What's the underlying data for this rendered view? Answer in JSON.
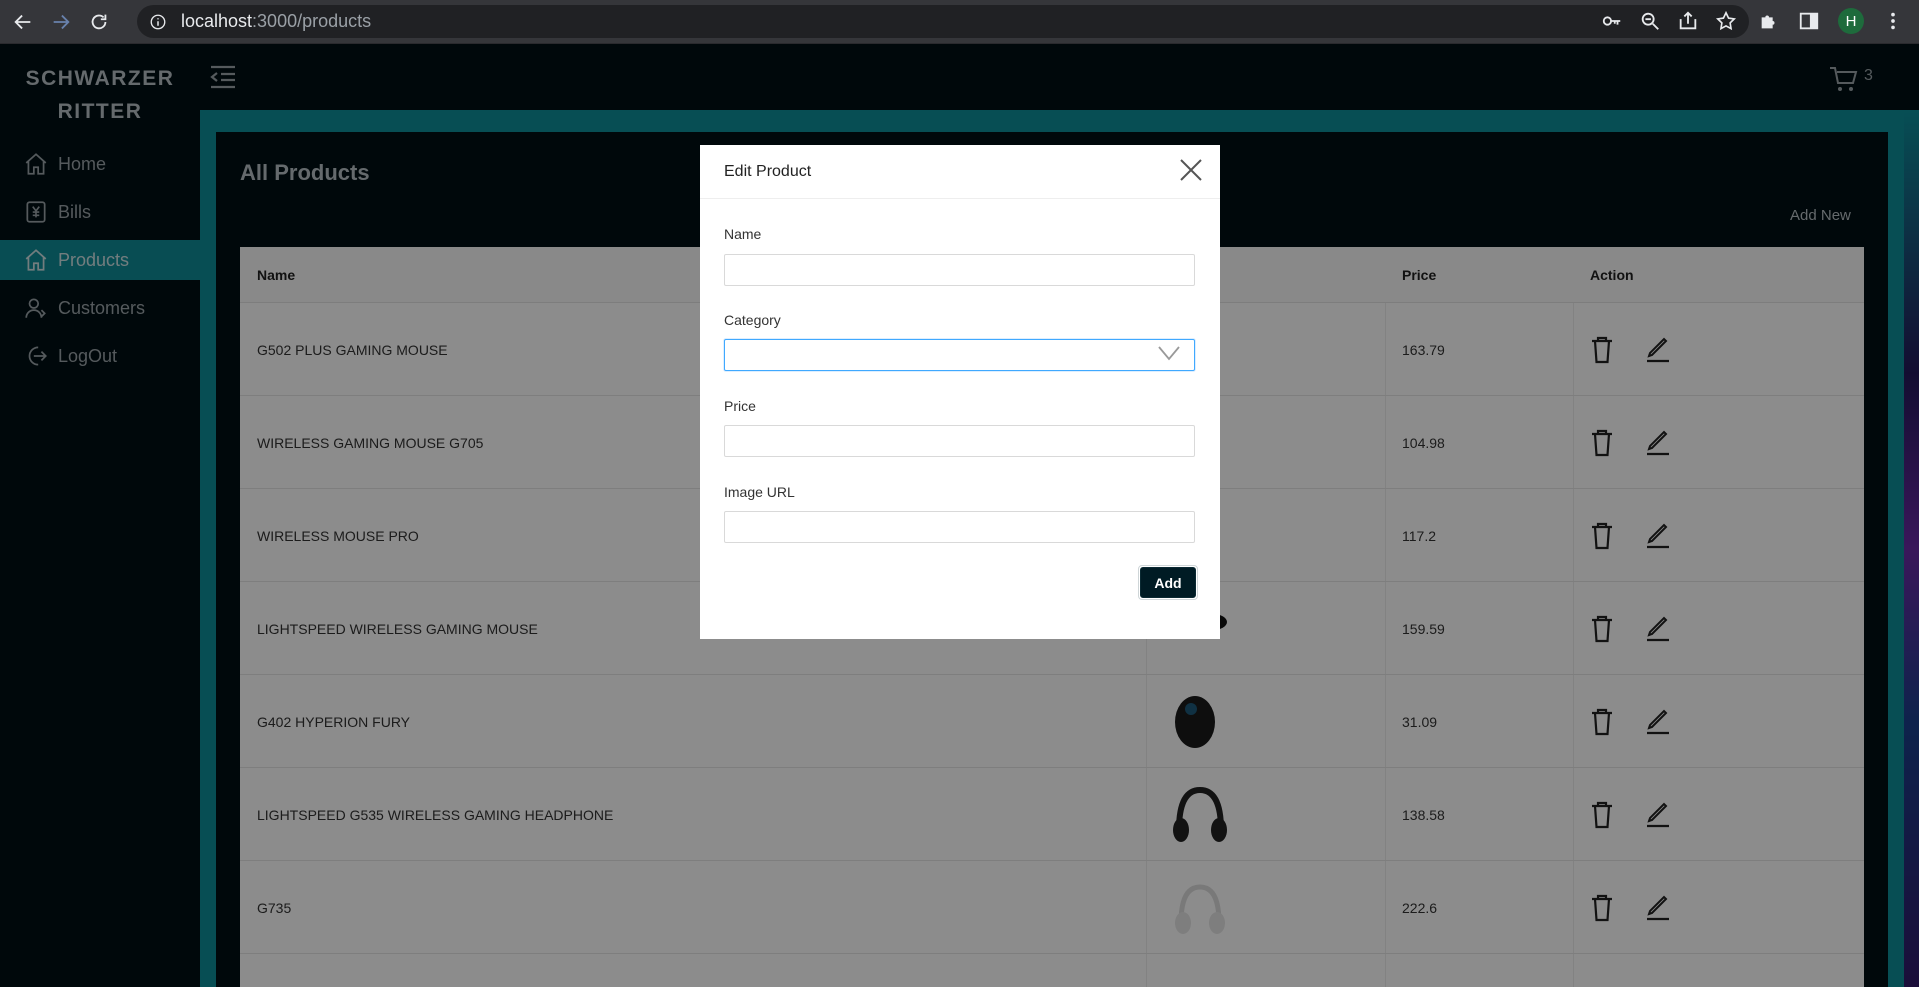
{
  "browser": {
    "url_host": "localhost",
    "url_path": ":3000/products",
    "profile_initial": "H"
  },
  "app": {
    "brand_line1": "SCHWARZER",
    "brand_line2": "RITTER",
    "cart_count": "3",
    "nav": [
      {
        "label": "Home",
        "icon": "home-icon",
        "active": false
      },
      {
        "label": "Bills",
        "icon": "yen-icon",
        "active": false
      },
      {
        "label": "Products",
        "icon": "home-icon",
        "active": true
      },
      {
        "label": "Customers",
        "icon": "user-icon",
        "active": false
      },
      {
        "label": "LogOut",
        "icon": "logout-icon",
        "active": false
      }
    ]
  },
  "page": {
    "title": "All Products",
    "add_new": "Add New"
  },
  "table": {
    "headers": {
      "name": "Name",
      "price": "Price",
      "action": "Action"
    },
    "rows": [
      {
        "name": "G502 PLUS GAMING MOUSE",
        "price": "163.79"
      },
      {
        "name": "WIRELESS GAMING MOUSE G705",
        "price": "104.98"
      },
      {
        "name": "WIRELESS MOUSE PRO",
        "price": "117.2"
      },
      {
        "name": "LIGHTSPEED WIRELESS GAMING MOUSE",
        "price": "159.59"
      },
      {
        "name": "G402 HYPERION FURY",
        "price": "31.09"
      },
      {
        "name": "LIGHTSPEED G535 WIRELESS GAMING HEADPHONE",
        "price": "138.58"
      },
      {
        "name": "G735",
        "price": "222.6"
      }
    ]
  },
  "modal": {
    "title": "Edit Product",
    "fields": {
      "name_label": "Name",
      "name_value": "",
      "category_label": "Category",
      "category_value": "",
      "price_label": "Price",
      "price_value": "",
      "image_label": "Image URL",
      "image_value": ""
    },
    "submit_label": "Add"
  },
  "colors": {
    "sidebar_bg": "#000f14",
    "accent": "#0f8c98",
    "button_bg": "#001b24"
  }
}
